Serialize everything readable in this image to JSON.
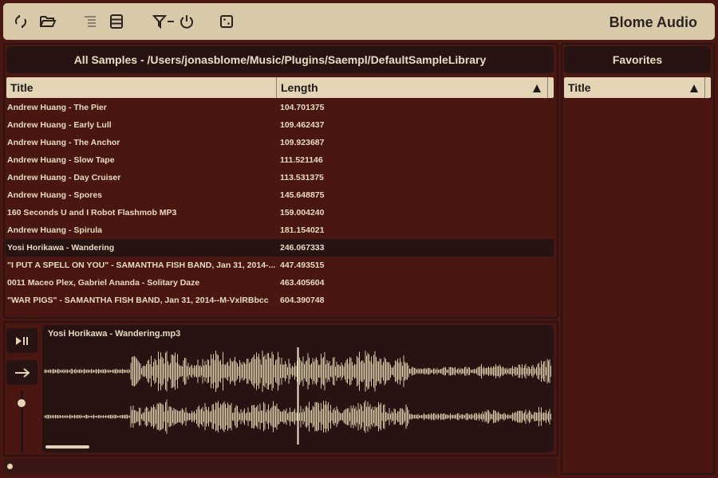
{
  "app": {
    "brand": "Blome Audio"
  },
  "toolbar": {
    "icons": [
      "refresh-icon",
      "folder-open-icon",
      "list-indent-icon",
      "table-rows-icon",
      "filter-icon",
      "power-icon",
      "dice-icon"
    ]
  },
  "library": {
    "title": "All Samples - /Users/jonasblome/Music/Plugins/Saempl/DefaultSampleLibrary",
    "columns": [
      "Title",
      "Length"
    ],
    "rows": [
      {
        "title": "Andrew Huang - The Pier",
        "length": "104.701375"
      },
      {
        "title": "Andrew Huang - Early Lull",
        "length": "109.462437"
      },
      {
        "title": "Andrew Huang - The Anchor",
        "length": "109.923687"
      },
      {
        "title": "Andrew Huang - Slow Tape",
        "length": "111.521146"
      },
      {
        "title": "Andrew Huang - Day Cruiser",
        "length": "113.531375"
      },
      {
        "title": "Andrew Huang - Spores",
        "length": "145.648875"
      },
      {
        "title": "160 Seconds U and I Robot Flashmob MP3",
        "length": "159.004240"
      },
      {
        "title": "Andrew Huang - Spirula",
        "length": "181.154021"
      },
      {
        "title": "Yosi Horikawa - Wandering",
        "length": "246.067333"
      },
      {
        "title": "\"I PUT A SPELL ON YOU\" - SAMANTHA FISH BAND,   Jan 31, 2014-...",
        "length": "447.493515"
      },
      {
        "title": "0011 Maceo Plex, Gabriel Ananda - Solitary Daze",
        "length": "463.405604"
      },
      {
        "title": "\"WAR PIGS\" - SAMANTHA FISH BAND,   Jan 31, 2014--M-VxlRBbcc",
        "length": "604.390748"
      }
    ],
    "selected_index": 8
  },
  "favorites": {
    "title": "Favorites",
    "columns": [
      "Title"
    ]
  },
  "player": {
    "filename": "Yosi Horikawa - Wandering.mp3",
    "playhead_fraction": 0.5,
    "volume_fraction": 0.8
  },
  "colors": {
    "background": "#4a1612",
    "panel_dark": "#271311",
    "cream": "#e2d4b5",
    "text": "#e6dac1"
  }
}
